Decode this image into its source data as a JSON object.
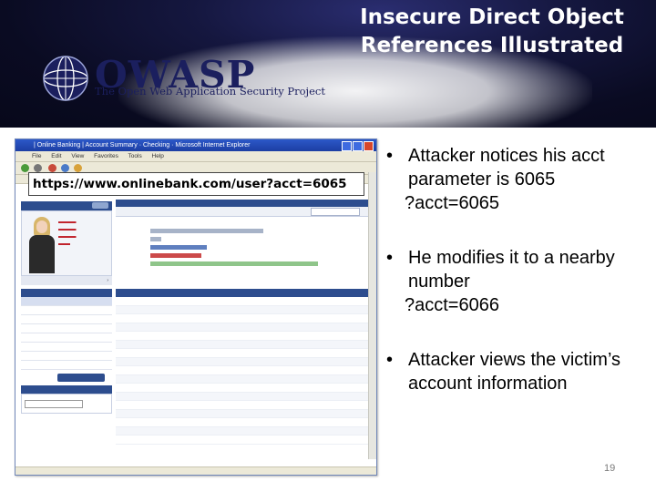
{
  "slide": {
    "title": "Insecure Direct Object References Illustrated",
    "page_number": "19"
  },
  "logo": {
    "name": "OWASP",
    "tagline": "The Open Web Application Security Project"
  },
  "browser": {
    "window_title": "| Online Banking | Account Summary · Checking · Microsoft Internet Explorer",
    "menu": [
      "File",
      "Edit",
      "View",
      "Favorites",
      "Tools",
      "Help"
    ],
    "url": "https://www.onlinebank.com/user?acct=6065"
  },
  "bullets": [
    {
      "text": "Attacker notices his acct parameter is 6065",
      "code": "?acct=6065"
    },
    {
      "text": "He modifies it to a nearby number",
      "code": "?acct=6066"
    },
    {
      "text": "Attacker views the victim’s account information",
      "code": ""
    }
  ],
  "colors": {
    "banner_dark": "#0a0b22",
    "bank_navy": "#2d4d8e",
    "bar_gray": "#a7b3c8",
    "bar_blue": "#5f7fbf",
    "bar_red": "#cc4a4a",
    "bar_green": "#8fc58a"
  }
}
